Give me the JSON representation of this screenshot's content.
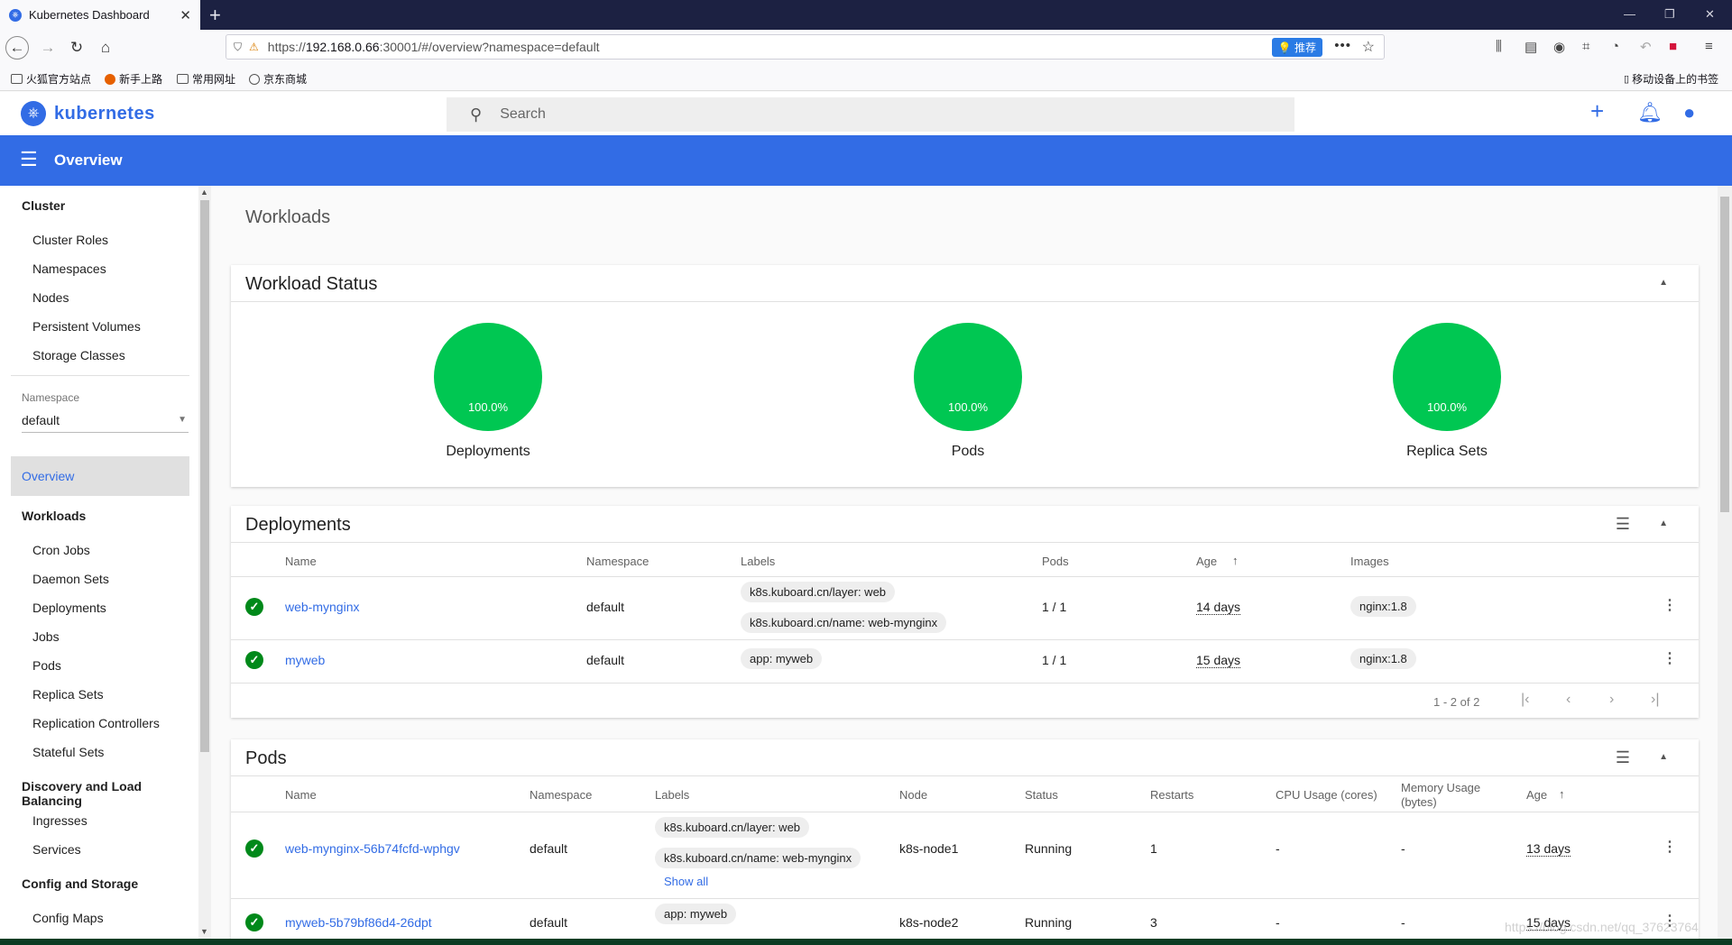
{
  "browser": {
    "tab_title": "Kubernetes Dashboard",
    "url_scheme": "https://",
    "url_host": "192.168.0.66",
    "url_rest": ":30001/#/overview?namespace=default",
    "recommend_label": "推荐",
    "bookmarks": [
      "火狐官方站点",
      "新手上路",
      "常用网址",
      "京东商城"
    ],
    "mobile_bookmarks": "移动设备上的书签"
  },
  "app": {
    "logo_text": "kubernetes",
    "search_placeholder": "Search",
    "page_title": "Overview"
  },
  "sidebar": {
    "cluster_heading": "Cluster",
    "cluster_items": [
      "Cluster Roles",
      "Namespaces",
      "Nodes",
      "Persistent Volumes",
      "Storage Classes"
    ],
    "namespace_label": "Namespace",
    "namespace_value": "default",
    "active_item": "Overview",
    "workloads_heading": "Workloads",
    "workloads_items": [
      "Cron Jobs",
      "Daemon Sets",
      "Deployments",
      "Jobs",
      "Pods",
      "Replica Sets",
      "Replication Controllers",
      "Stateful Sets"
    ],
    "discovery_heading": "Discovery and Load Balancing",
    "discovery_items": [
      "Ingresses",
      "Services"
    ],
    "config_heading": "Config and Storage",
    "config_items": [
      "Config Maps"
    ]
  },
  "main": {
    "section_heading": "Workloads",
    "workload_status": {
      "title": "Workload Status",
      "items": [
        {
          "label": "Deployments",
          "value": "100.0%"
        },
        {
          "label": "Pods",
          "value": "100.0%"
        },
        {
          "label": "Replica Sets",
          "value": "100.0%"
        }
      ],
      "color": "#00c752"
    },
    "deployments": {
      "title": "Deployments",
      "columns": [
        "Name",
        "Namespace",
        "Labels",
        "Pods",
        "Age",
        "Images"
      ],
      "rows": [
        {
          "name": "web-mynginx",
          "namespace": "default",
          "labels": [
            "k8s.kuboard.cn/layer: web",
            "k8s.kuboard.cn/name: web-mynginx"
          ],
          "pods": "1 / 1",
          "age": "14 days",
          "image": "nginx:1.8"
        },
        {
          "name": "myweb",
          "namespace": "default",
          "labels": [
            "app: myweb"
          ],
          "pods": "1 / 1",
          "age": "15 days",
          "image": "nginx:1.8"
        }
      ],
      "pagination": "1 - 2 of 2"
    },
    "pods": {
      "title": "Pods",
      "columns": [
        "Name",
        "Namespace",
        "Labels",
        "Node",
        "Status",
        "Restarts",
        "CPU Usage (cores)",
        "Memory Usage",
        "(bytes)",
        "Age"
      ],
      "rows": [
        {
          "name": "web-mynginx-56b74fcfd-wphgv",
          "namespace": "default",
          "labels": [
            "k8s.kuboard.cn/layer: web",
            "k8s.kuboard.cn/name: web-mynginx"
          ],
          "show_all": "Show all",
          "node": "k8s-node1",
          "status": "Running",
          "restarts": "1",
          "cpu": "-",
          "memory": "-",
          "age": "13 days"
        },
        {
          "name": "myweb-5b79bf86d4-26dpt",
          "namespace": "default",
          "labels": [
            "app: myweb"
          ],
          "node": "k8s-node2",
          "status": "Running",
          "restarts": "3",
          "cpu": "-",
          "memory": "-",
          "age": "15 days"
        }
      ]
    }
  },
  "watermark": "https://blog.csdn.net/qq_37623764",
  "colors": {
    "accent": "#326ce5",
    "success": "#00891a"
  }
}
